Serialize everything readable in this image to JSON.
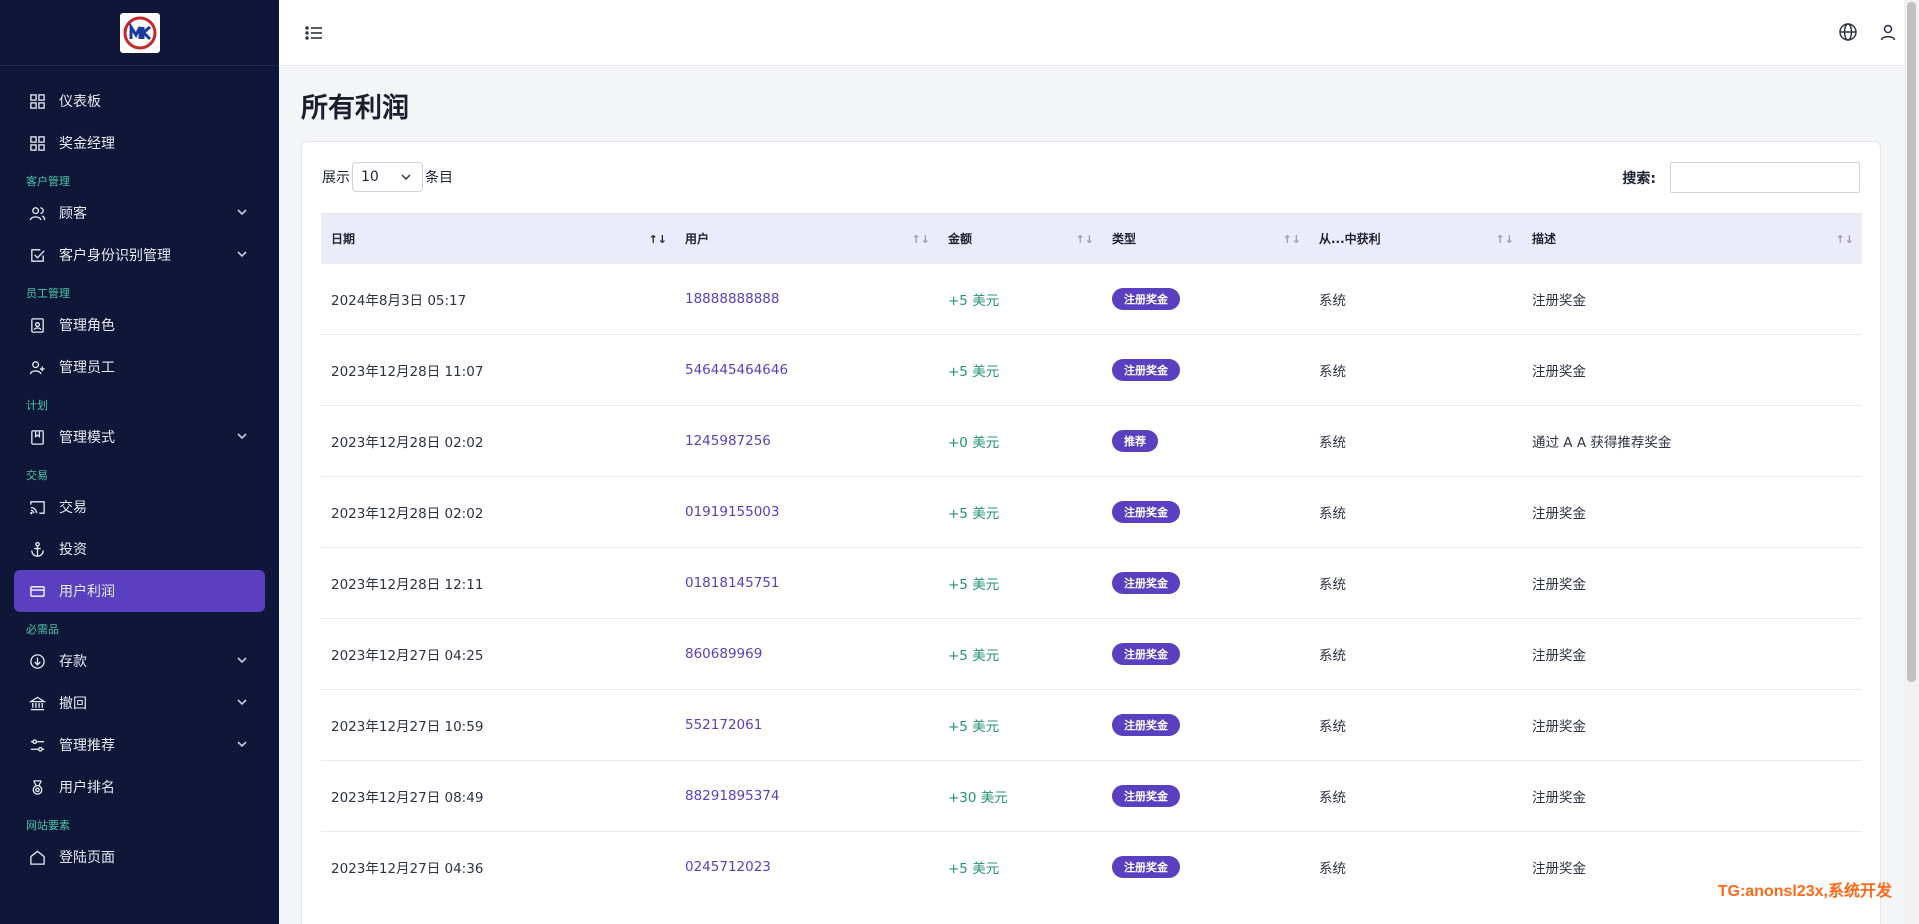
{
  "sidebar": {
    "items": [
      {
        "label": "仪表板",
        "icon": "dashboard-icon"
      },
      {
        "label": "奖金经理",
        "icon": "dashboard-icon"
      },
      {
        "section": "客户管理"
      },
      {
        "label": "顾客",
        "icon": "users-icon",
        "chevron": true
      },
      {
        "label": "客户身份识别管理",
        "icon": "check-square-icon",
        "chevron": true
      },
      {
        "section": "员工管理"
      },
      {
        "label": "管理角色",
        "icon": "id-card-icon"
      },
      {
        "label": "管理员工",
        "icon": "user-plus-icon"
      },
      {
        "section": "计划"
      },
      {
        "label": "管理模式",
        "icon": "book-icon",
        "chevron": true
      },
      {
        "section": "交易"
      },
      {
        "label": "交易",
        "icon": "cast-icon"
      },
      {
        "label": "投资",
        "icon": "anchor-icon"
      },
      {
        "label": "用户利润",
        "icon": "credit-card-icon",
        "active": true
      },
      {
        "section": "必需品"
      },
      {
        "label": "存款",
        "icon": "arrow-down-circle-icon",
        "chevron": true
      },
      {
        "label": "撤回",
        "icon": "bank-icon",
        "chevron": true
      },
      {
        "label": "管理推荐",
        "icon": "sliders-icon",
        "chevron": true
      },
      {
        "label": "用户排名",
        "icon": "medal-icon"
      },
      {
        "section": "网站要素"
      },
      {
        "label": "登陆页面",
        "icon": "home-icon"
      }
    ]
  },
  "page": {
    "title": "所有利润"
  },
  "controls": {
    "show_label": "展示",
    "page_size": "10",
    "entries_label": "条目",
    "search_label": "搜索:",
    "search_value": ""
  },
  "table": {
    "columns": [
      "日期",
      "用户",
      "金额",
      "类型",
      "从...中获利",
      "描述"
    ],
    "rows": [
      {
        "date": "2024年8月3日 05:17",
        "user": "18888888888",
        "amount": "+5 美元",
        "type": "注册奖金",
        "from": "系统",
        "desc": "注册奖金"
      },
      {
        "date": "2023年12月28日 11:07",
        "user": "546445464646",
        "amount": "+5 美元",
        "type": "注册奖金",
        "from": "系统",
        "desc": "注册奖金"
      },
      {
        "date": "2023年12月28日 02:02",
        "user": "1245987256",
        "amount": "+0 美元",
        "type": "推荐",
        "from": "系统",
        "desc": "通过 A A 获得推荐奖金"
      },
      {
        "date": "2023年12月28日 02:02",
        "user": "01919155003",
        "amount": "+5 美元",
        "type": "注册奖金",
        "from": "系统",
        "desc": "注册奖金"
      },
      {
        "date": "2023年12月28日 12:11",
        "user": "01818145751",
        "amount": "+5 美元",
        "type": "注册奖金",
        "from": "系统",
        "desc": "注册奖金"
      },
      {
        "date": "2023年12月27日 04:25",
        "user": "860689969",
        "amount": "+5 美元",
        "type": "注册奖金",
        "from": "系统",
        "desc": "注册奖金"
      },
      {
        "date": "2023年12月27日 10:59",
        "user": "552172061",
        "amount": "+5 美元",
        "type": "注册奖金",
        "from": "系统",
        "desc": "注册奖金"
      },
      {
        "date": "2023年12月27日 08:49",
        "user": "88291895374",
        "amount": "+30 美元",
        "type": "注册奖金",
        "from": "系统",
        "desc": "注册奖金"
      },
      {
        "date": "2023年12月27日 04:36",
        "user": "0245712023",
        "amount": "+5 美元",
        "type": "注册奖金",
        "from": "系统",
        "desc": "注册奖金"
      }
    ]
  },
  "watermark": "TG:anonsl23x,系统开发",
  "colors": {
    "sidebar_bg": "#0f1638",
    "accent": "#5a3fc0",
    "section_label": "#4dc6a8",
    "amount_positive": "#22946b",
    "watermark": "#ff6a1a"
  }
}
